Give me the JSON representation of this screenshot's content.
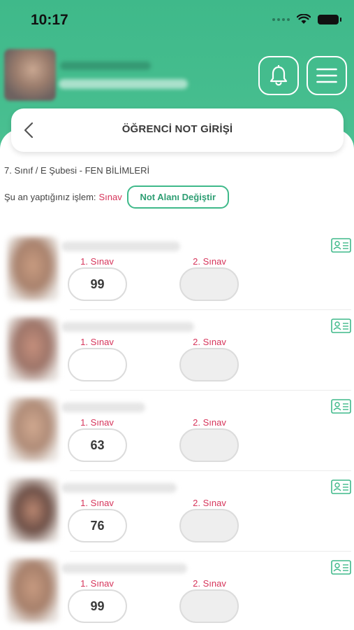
{
  "status_bar": {
    "time": "10:17"
  },
  "header": {
    "title": "ÖĞRENCİ NOT GİRİŞİ",
    "bell_icon": "bell-icon",
    "menu_icon": "menu-icon",
    "back_icon": "chevron-left-icon"
  },
  "info": {
    "class_line": "7. Sınıf / E Şubesi - FEN BİLİMLERİ",
    "operation_label": "Şu an yaptığınız işlem:",
    "operation_value": "Sınav",
    "change_button": "Not Alanı Değiştir"
  },
  "students": [
    {
      "exam1_label": "1. Sınav",
      "exam2_label": "2. Sınav",
      "exam1_score": "99",
      "exam2_score": ""
    },
    {
      "exam1_label": "1. Sınav",
      "exam2_label": "2. Sınav",
      "exam1_score": "",
      "exam2_score": ""
    },
    {
      "exam1_label": "1. Sınav",
      "exam2_label": "2. Sınav",
      "exam1_score": "63",
      "exam2_score": ""
    },
    {
      "exam1_label": "1. Sınav",
      "exam2_label": "2. Sınav",
      "exam1_score": "76",
      "exam2_score": ""
    },
    {
      "exam1_label": "1. Sınav",
      "exam2_label": "2. Sınav",
      "exam1_score": "99",
      "exam2_score": ""
    }
  ],
  "colors": {
    "brand_green": "#3fb98a",
    "exam_label_red": "#d6345a"
  }
}
